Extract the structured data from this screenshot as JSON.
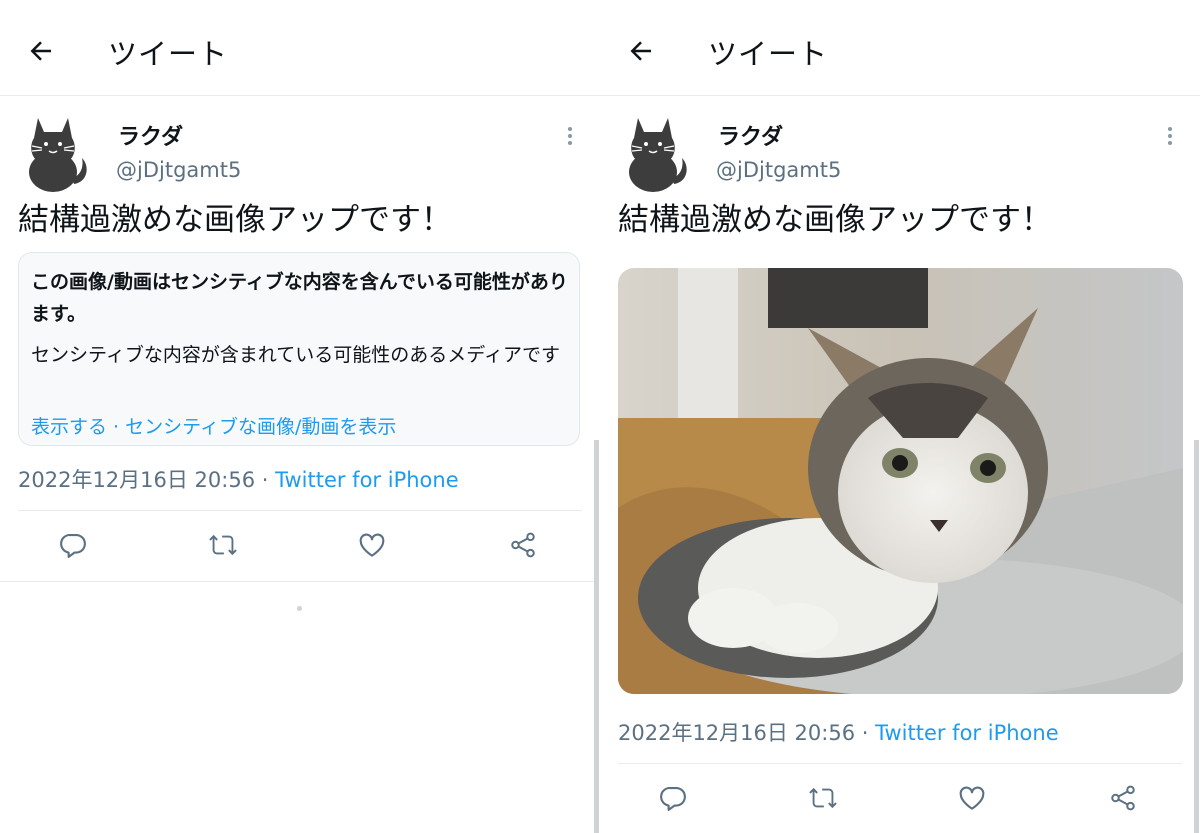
{
  "header": {
    "title": "ツイート"
  },
  "tweet": {
    "name": "ラクダ",
    "handle": "@jDjtgamt5",
    "text": "結構過激めな画像アップです！",
    "timestamp": "2022年12月16日 20:56",
    "separator": " · ",
    "source": "Twitter for iPhone"
  },
  "sensitive_notice": {
    "title": "この画像/動画はセンシティブな内容を含んでいる可能性があります。",
    "description": "センシティブな内容が含まれている可能性のあるメディアです",
    "show_link": "表示する · センシティブな画像/動画を表示"
  },
  "icons": {
    "back": "back-arrow-icon",
    "more": "more-vertical-icon",
    "reply": "reply-icon",
    "retweet": "retweet-icon",
    "like": "heart-icon",
    "share": "share-icon"
  },
  "colors": {
    "accent": "#1d9bf0",
    "secondary_text": "#5b7083",
    "border": "#e6ecf0"
  }
}
